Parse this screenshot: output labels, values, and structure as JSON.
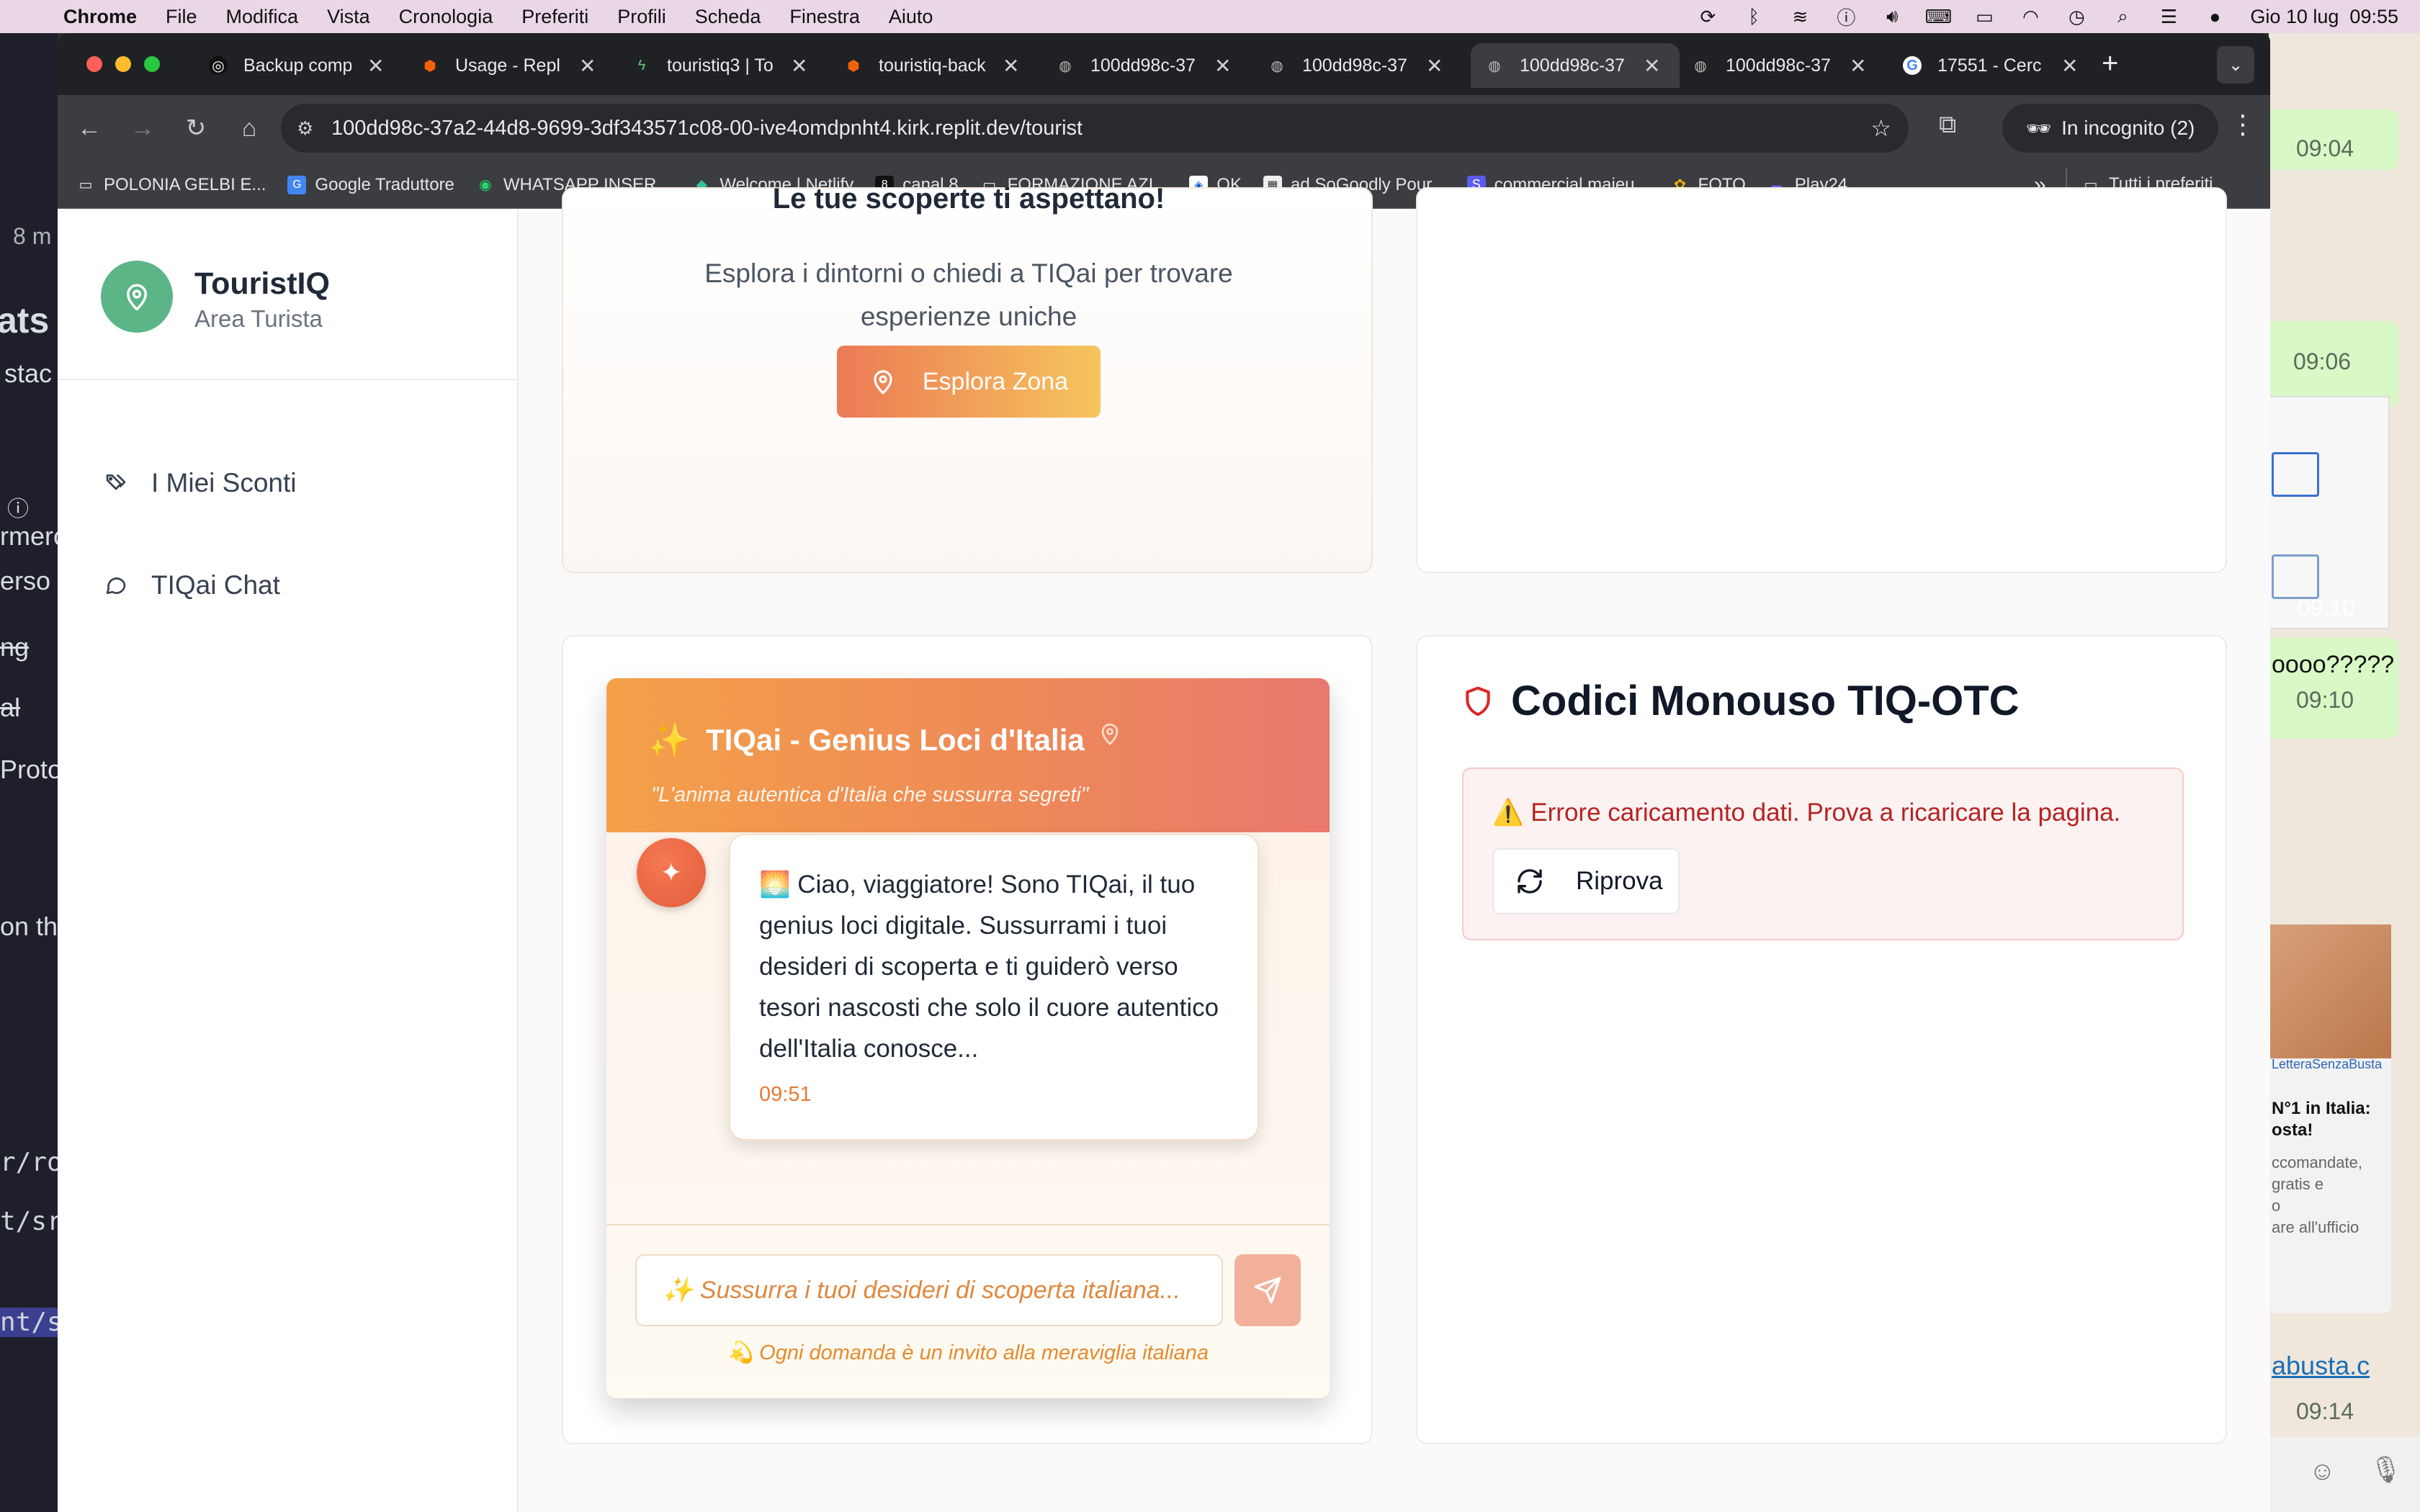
{
  "menubar": {
    "app": "Chrome",
    "items": [
      "File",
      "Modifica",
      "Vista",
      "Cronologia",
      "Preferiti",
      "Profili",
      "Scheda",
      "Finestra",
      "Aiuto"
    ],
    "datetime": "Gio 10 lug  09:55"
  },
  "tabs": [
    {
      "title": "Backup comp"
    },
    {
      "title": "Usage - Repl"
    },
    {
      "title": "touristiq3 | To"
    },
    {
      "title": "touristiq-back"
    },
    {
      "title": "100dd98c-37"
    },
    {
      "title": "100dd98c-37"
    },
    {
      "title": "100dd98c-37"
    },
    {
      "title": "100dd98c-37"
    },
    {
      "title": "17551 - Cerc"
    }
  ],
  "address": "100dd98c-37a2-44d8-9699-3df343571c08-00-ive4omdpnht4.kirk.replit.dev/tourist",
  "incognito": "In incognito (2)",
  "bookmarks": [
    "POLONIA GELBI E...",
    "Google Traduttore",
    "WHATSAPP INSER...",
    "Welcome | Netlify",
    "canal 8",
    "FORMAZIONE AZI...",
    "OK",
    "ad SoGoodly Pour...",
    "commercial maieu...",
    "FOTO",
    "Play24"
  ],
  "bookmarks_more": "»",
  "all_bookmarks": "Tutti i preferiti",
  "sidebar": {
    "brand": "TouristIQ",
    "subtitle": "Area Turista",
    "items": [
      {
        "label": "I Miei Sconti"
      },
      {
        "label": "TIQai Chat"
      }
    ]
  },
  "discover": {
    "title": "Le tue scoperte ti aspettano!",
    "desc": "Esplora i dintorni o chiedi a TIQai per trovare esperienze uniche",
    "button": "Esplora Zona"
  },
  "chat": {
    "title": "TIQai - Genius Loci d'Italia",
    "subtitle": "\"L'anima autentica d'Italia che sussurra segreti\"",
    "message": "🌅 Ciao, viaggiatore! Sono TIQai, il tuo genius loci digitale. Sussurrami i tuoi desideri di scoperta e ti guiderò verso tesori nascosti che solo il cuore autentico dell'Italia conosce...",
    "time": "09:51",
    "placeholder": "✨ Sussurra i tuoi desideri di scoperta italiana...",
    "footer": "💫 Ogni domanda è un invito alla meraviglia italiana"
  },
  "otc": {
    "title": "Codici Monouso TIQ-OTC",
    "error": "⚠️ Errore caricamento dati. Prova a ricaricare la pagina.",
    "retry": "Riprova"
  },
  "bg_left": [
    "8 m",
    "ats",
    "stac",
    "rmerc",
    "erso",
    "ng",
    "al",
    "Proto",
    "on the",
    "r/ro",
    "t/sr",
    "nt/s"
  ],
  "bg_right": {
    "times": [
      "09:04",
      "09:06",
      "09:10",
      "09:10",
      "09:14"
    ],
    "msg": "oooo?????",
    "ad_title": "N°1 in Italia:",
    "ad_title2": "osta!",
    "ad_body": "ccomandate,",
    "ad_body2": "gratis e",
    "ad_body3": "o",
    "ad_body4": "are all'ufficio",
    "link": "abusta.c",
    "logo": "LetteraSenzaBusta"
  }
}
